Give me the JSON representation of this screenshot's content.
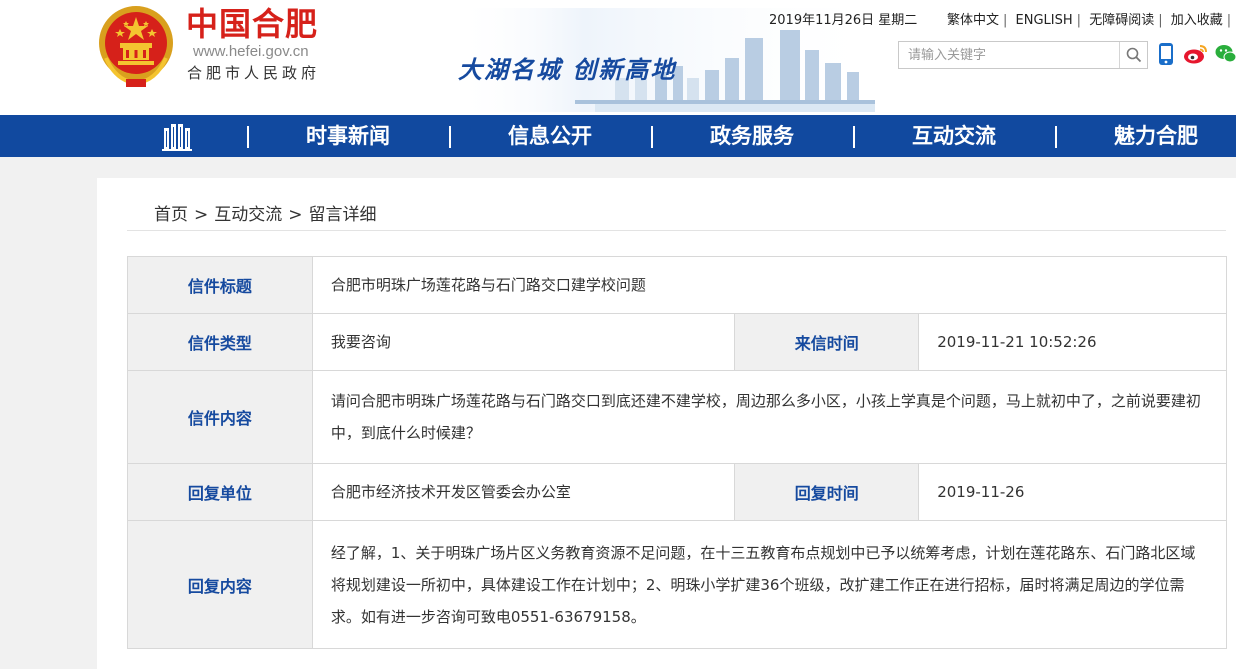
{
  "header": {
    "site_title": "中国合肥",
    "site_url": "www.hefei.gov.cn",
    "site_subtitle": "合肥市人民政府",
    "slogan": "大湖名城  创新高地",
    "date": "2019年11月26日 星期二",
    "toplinks": [
      "繁体中文",
      "ENGLISH",
      "无障碍阅读",
      "加入收藏"
    ],
    "search_placeholder": "请输入关键字",
    "icons": [
      "national-emblem-icon",
      "search-icon",
      "mobile-icon",
      "weibo-icon",
      "wechat-icon"
    ]
  },
  "nav": {
    "home_icon": "city-building-icon",
    "items": [
      "时事新闻",
      "信息公开",
      "政务服务",
      "互动交流",
      "魅力合肥"
    ],
    "color": "#11499f"
  },
  "breadcrumb": {
    "items": [
      "首页",
      "互动交流",
      "留言详细"
    ],
    "separator": ">"
  },
  "letter": {
    "title_label": "信件标题",
    "title": "合肥市明珠广场莲花路与石门路交口建学校问题",
    "type_label": "信件类型",
    "type": "我要咨询",
    "time_label": "来信时间",
    "time": "2019-11-21 10:52:26",
    "content_label": "信件内容",
    "content": "请问合肥市明珠广场莲花路与石门路交口到底还建不建学校，周边那么多小区，小孩上学真是个问题，马上就初中了，之前说要建初中，到底什么时候建？",
    "reply_unit_label": "回复单位",
    "reply_unit": "合肥市经济技术开发区管委会办公室",
    "reply_time_label": "回复时间",
    "reply_time": "2019-11-26",
    "reply_content_label": "回复内容",
    "reply_content": "经了解，1、关于明珠广场片区义务教育资源不足问题，在十三五教育布点规划中已予以统筹考虑，计划在莲花路东、石门路北区域将规划建设一所初中，具体建设工作在计划中；2、明珠小学扩建36个班级，改扩建工作正在进行招标，届时将满足周边的学位需求。如有进一步咨询可致电0551-63679158。"
  },
  "colors": {
    "brand_red": "#d6211a",
    "brand_blue": "#11499f",
    "label_blue": "#164a9f"
  }
}
